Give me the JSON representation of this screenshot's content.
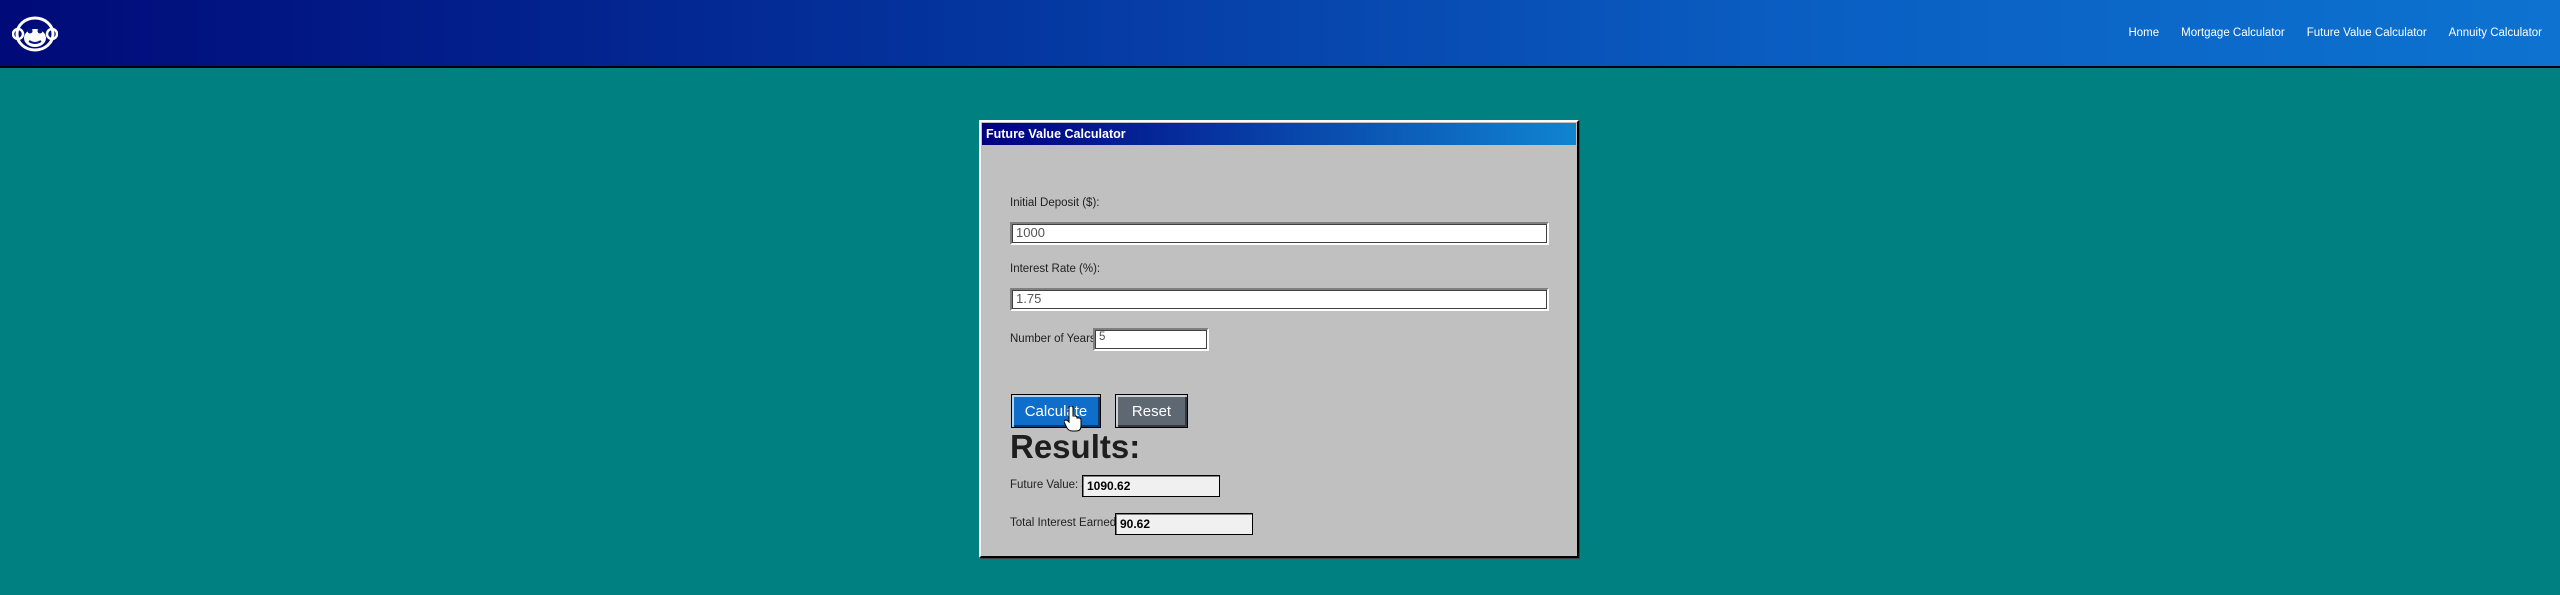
{
  "nav": {
    "items": [
      "Home",
      "Mortgage Calculator",
      "Future Value Calculator",
      "Annuity Calculator"
    ]
  },
  "window": {
    "title": "Future Value Calculator"
  },
  "form": {
    "initial_deposit_label": "Initial Deposit ($):",
    "initial_deposit_value": "1000",
    "interest_rate_label": "Interest Rate (%):",
    "interest_rate_value": "1.75",
    "years_label": "Number of Years:",
    "years_value": "5",
    "calculate_label": "Calculate",
    "reset_label": "Reset"
  },
  "results": {
    "heading": "Results:",
    "future_value_label": "Future Value: $",
    "future_value": "1090.62",
    "total_interest_label": "Total Interest Earned: $",
    "total_interest": "90.62"
  },
  "colors": {
    "background": "#008080",
    "window": "#c0c0c0",
    "calculate_button": "#0f6ec9",
    "reset_button": "#5e6873"
  },
  "icons": {
    "logo": "monkey-logo-icon",
    "cursor": "hand-pointer-cursor"
  }
}
